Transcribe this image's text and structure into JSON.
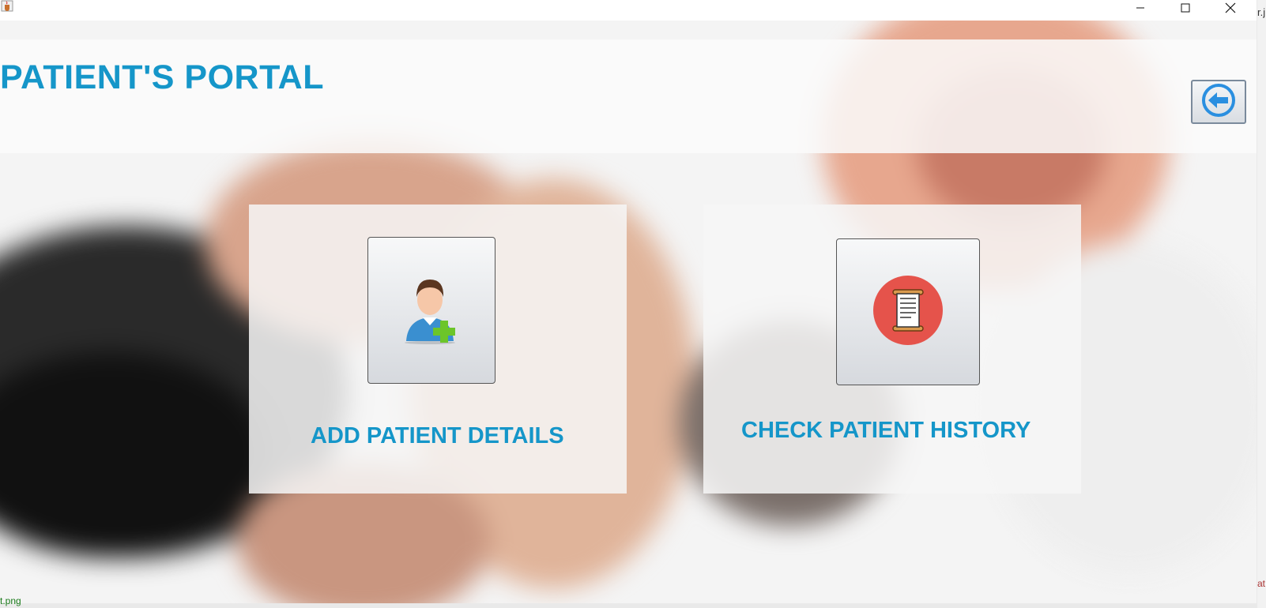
{
  "window": {
    "app_icon": "java-cup-icon",
    "controls": [
      "minimize-icon",
      "maximize-icon",
      "close-icon"
    ]
  },
  "header": {
    "title": "PATIENT'S PORTAL",
    "back_icon": "arrow-left-circle-icon"
  },
  "actions": [
    {
      "label": "ADD PATIENT DETAILS",
      "icon": "add-user-icon"
    },
    {
      "label": "CHECK PATIENT HISTORY",
      "icon": "scroll-document-icon"
    }
  ],
  "background_fragments": {
    "side_top": "r.j",
    "side_bottom": "at",
    "bottom_left": "t.png"
  },
  "colors": {
    "accent": "#1596c9",
    "back_arrow": "#2a8fe0",
    "history_badge": "#e5534b",
    "add_plus": "#5fbf2a"
  }
}
